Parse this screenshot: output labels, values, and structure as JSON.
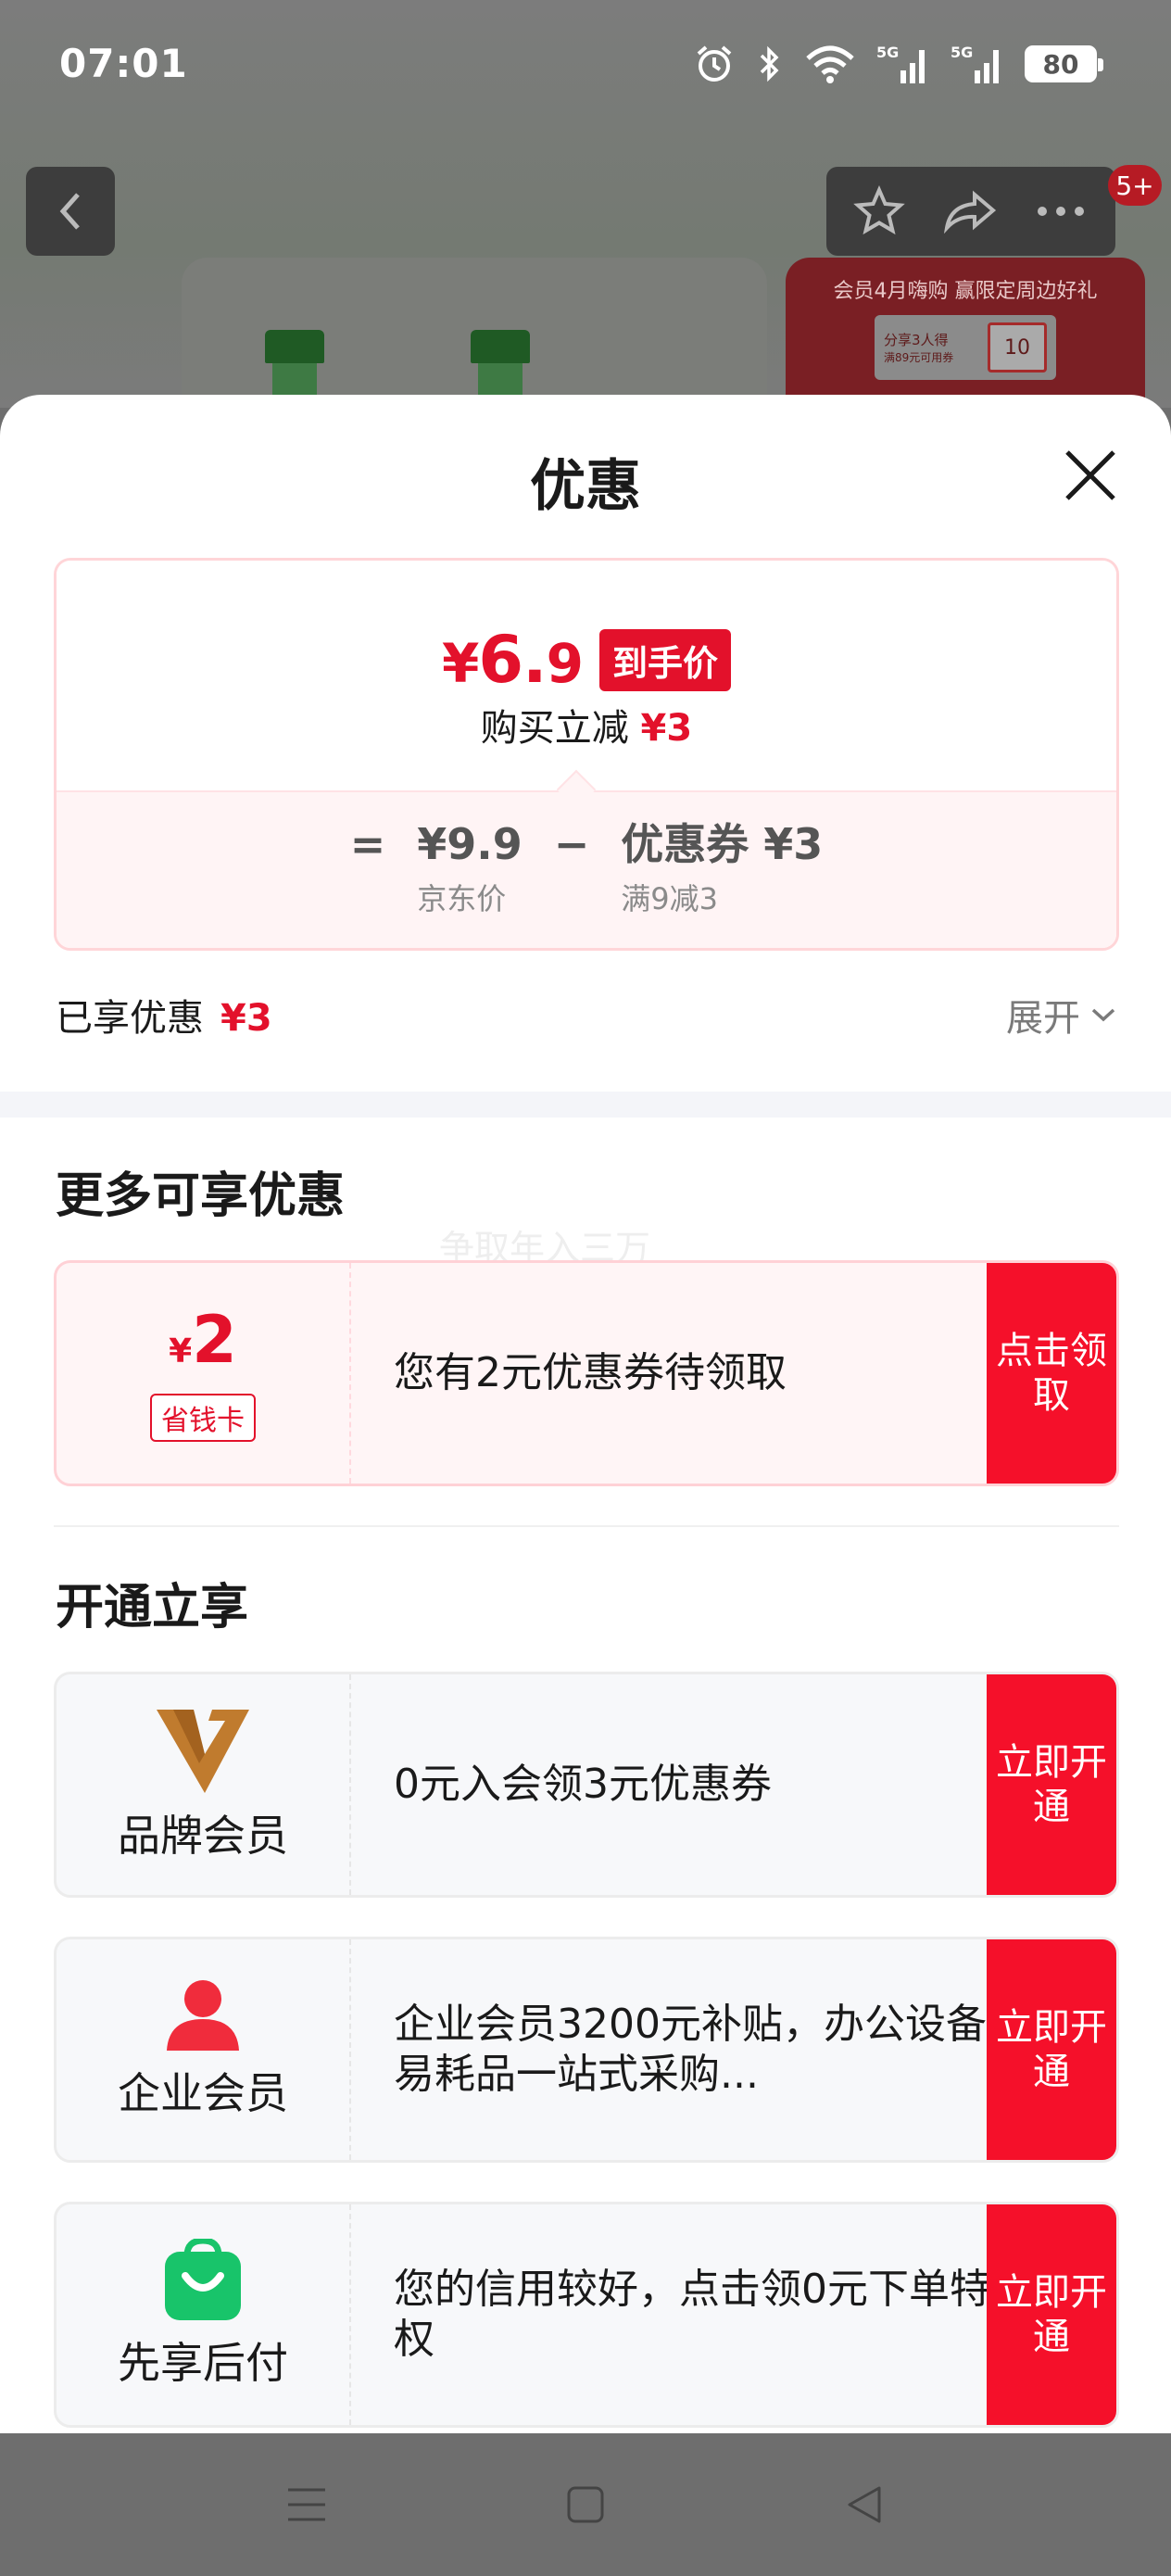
{
  "status_bar": {
    "time": "07:01",
    "battery": "80",
    "icons": [
      "alarm-icon",
      "bluetooth-icon",
      "wifi-icon",
      "signal-5g-icon",
      "signal-5g-icon",
      "battery-icon"
    ]
  },
  "background_page": {
    "badge": "5+",
    "promo_title": "会员4月嗨购 赢限定周边好礼",
    "promo_box_line1": "分享3人得",
    "promo_box_line2": "满89元可用券",
    "promo_ticket": "10"
  },
  "sheet": {
    "title": "优惠",
    "price_card": {
      "final_symbol": "¥",
      "final_int": "6.",
      "final_dec": "9",
      "final_tag": "到手价",
      "reduce_prefix": "购买立减",
      "reduce_value": "¥3",
      "formula": {
        "equals": "=",
        "jd_price": "¥9.9",
        "jd_price_label": "京东价",
        "minus": "−",
        "coupon": "优惠券 ¥3",
        "coupon_label": "满9减3"
      }
    },
    "enjoyed_label": "已享优惠",
    "enjoyed_value": "¥3",
    "expand_label": "展开",
    "more_section_title": "更多可享优惠",
    "watermark": "争取年入三万",
    "saver_offer": {
      "symbol": "¥",
      "amount": "2",
      "tag": "省钱卡",
      "desc": "您有2元优惠券待领取",
      "action": "点击领取"
    },
    "open_section_title": "开通立享",
    "member_offers": [
      {
        "label": "品牌会员",
        "icon": "brand-member-icon",
        "desc": "0元入会领3元优惠券",
        "action": "立即开通"
      },
      {
        "label": "企业会员",
        "icon": "enterprise-member-icon",
        "desc": "企业会员3200元补贴，办公设备/易耗品一站式采购...",
        "action": "立即开通"
      },
      {
        "label": "先享后付",
        "icon": "pay-later-icon",
        "desc": "您的信用较好，点击领0元下单特权",
        "action": "立即开通"
      }
    ]
  },
  "colors": {
    "accent_red": "#e3112b",
    "action_red": "#f5102a",
    "brand_gold": "#c07b2e",
    "pay_later_green": "#18c46a"
  }
}
